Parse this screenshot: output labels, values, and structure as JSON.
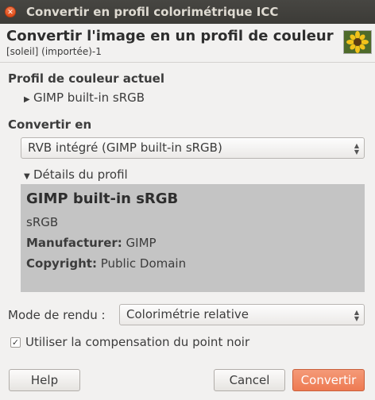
{
  "window": {
    "title": "Convertir en profil colorimétrique ICC"
  },
  "header": {
    "title": "Convertir l'image en un profil de couleur",
    "subtitle": "[soleil] (importée)-1"
  },
  "current_profile": {
    "heading": "Profil de couleur actuel",
    "profile": "GIMP built-in sRGB"
  },
  "convert_to": {
    "heading": "Convertir en",
    "selected": "RVB intégré (GIMP built-in sRGB)"
  },
  "details": {
    "label": "Détails du profil",
    "name": "GIMP built-in sRGB",
    "description": "sRGB",
    "manufacturer_label": "Manufacturer:",
    "manufacturer": "GIMP",
    "copyright_label": "Copyright:",
    "copyright": "Public Domain"
  },
  "render": {
    "label": "Mode de rendu :",
    "selected": "Colorimétrie relative"
  },
  "black_point": {
    "label": "Utiliser la compensation du point noir",
    "checked": true
  },
  "buttons": {
    "help": "Help",
    "cancel": "Cancel",
    "convert": "Convertir"
  }
}
